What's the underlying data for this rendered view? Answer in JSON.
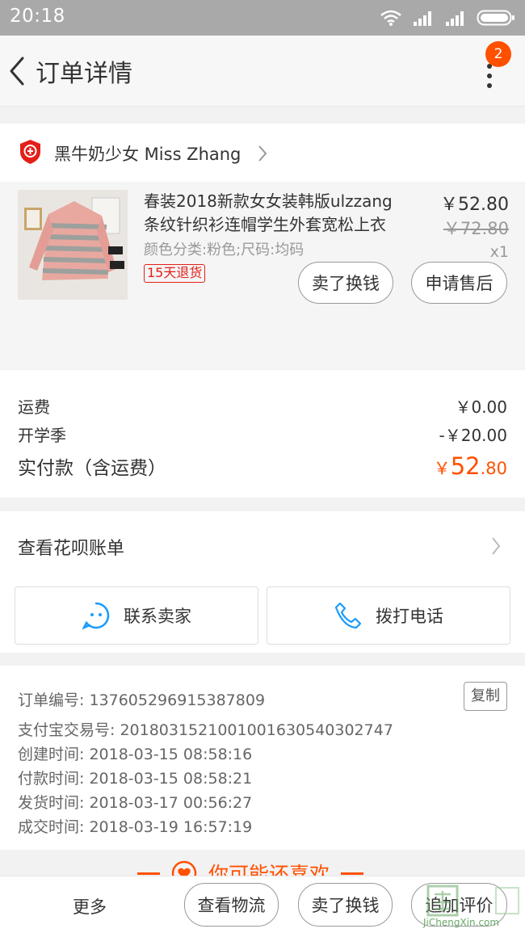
{
  "status_bar": {
    "time": "20:18"
  },
  "navbar": {
    "title": "订单详情",
    "badge_count": "2"
  },
  "shop": {
    "name": "黑牛奶少女 Miss Zhang"
  },
  "item": {
    "title_line1": "春装2018新款女女装韩版ulzzang",
    "title_line2": "条纹针织衫连帽学生外套宽松上衣",
    "spec": "颜色分类:粉色;尺码:均码",
    "return_tag": "15天退货",
    "price": "￥52.80",
    "original_price": "￥72.80",
    "quantity": "x1",
    "buttons": {
      "exchange": "卖了换钱",
      "after_sale": "申请售后"
    }
  },
  "fees": {
    "shipping_label": "运费",
    "shipping_value": "￥0.00",
    "discount_label": "开学季",
    "discount_value": "-￥20.00",
    "paid_label": "实付款（含运费）",
    "paid_currency": "￥",
    "paid_int": "52",
    "paid_dec": ".80"
  },
  "huabei": {
    "label": "查看花呗账单",
    "contact_seller": "联系卖家",
    "call_phone": "拨打电话"
  },
  "order_info": {
    "order_no": "订单编号: 137605296915387809",
    "copy_label": "复制",
    "alipay_no": "支付宝交易号: 2018031521001001630540302747",
    "created": "创建时间: 2018-03-15 08:58:16",
    "paid": "付款时间: 2018-03-15 08:58:21",
    "shipped": "发货时间: 2018-03-17 00:56:27",
    "closed": "成交时间: 2018-03-19 16:57:19"
  },
  "recommend": {
    "label": "你可能还喜欢"
  },
  "bottom_bar": {
    "more": "更多",
    "logistics": "查看物流",
    "exchange": "卖了换钱",
    "review": "追加评价"
  },
  "watermark": {
    "text": "JiChengXin.com"
  },
  "colors": {
    "accent": "#ff5000",
    "tag_red": "#e41f19",
    "icon_blue": "#1a9bfc"
  }
}
